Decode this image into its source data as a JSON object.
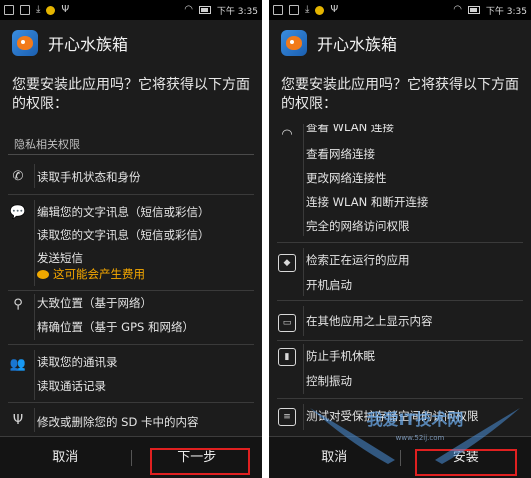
{
  "status_bar": {
    "time": "下午 3:35"
  },
  "app": {
    "title": "开心水族箱"
  },
  "prompt": "您要安装此应用吗？它将获得以下方面的权限：",
  "left": {
    "section_title": "隐私相关权限",
    "groups": [
      {
        "icon": "phone-icon",
        "items": [
          "读取手机状态和身份"
        ]
      },
      {
        "icon": "chat-bubble-icon",
        "items": [
          "编辑您的文字讯息（短信或彩信）",
          "读取您的文字讯息（短信或彩信）",
          "发送短信"
        ],
        "warning": "这可能会产生费用"
      },
      {
        "icon": "location-pin-icon",
        "items": [
          "大致位置（基于网络）",
          "精确位置（基于 GPS 和网络）"
        ]
      },
      {
        "icon": "contacts-icon",
        "items": [
          "读取您的通讯录",
          "读取通话记录"
        ]
      },
      {
        "icon": "usb-icon",
        "items": [
          "修改或删除您的 SD 卡中的内容"
        ]
      }
    ],
    "cancel_label": "取消",
    "next_label": "下一步"
  },
  "right": {
    "groups": [
      {
        "icon": "wifi-icon",
        "items": [
          "查看 WLAN 连接",
          "查看网络连接",
          "更改网络连接性",
          "连接 WLAN 和断开连接",
          "完全的网络访问权限"
        ]
      },
      {
        "icon": "running-apps-icon",
        "items": [
          "检索正在运行的应用",
          "开机启动"
        ]
      },
      {
        "icon": "overlay-window-icon",
        "items": [
          "在其他应用之上显示内容"
        ]
      },
      {
        "icon": "lock-sleep-icon",
        "items": [
          "防止手机休眠",
          "控制振动"
        ]
      },
      {
        "icon": "settings-sliders-icon",
        "items": [
          "测试对受保护存储空间的访问权限"
        ]
      }
    ],
    "cancel_label": "取消",
    "install_label": "安装"
  },
  "watermark": {
    "brand": "我爱IT技术网",
    "url": "www.52ij.com"
  },
  "colors": {
    "highlight": "#e02020",
    "warning": "#f6a800",
    "background": "#1c1c1c"
  }
}
